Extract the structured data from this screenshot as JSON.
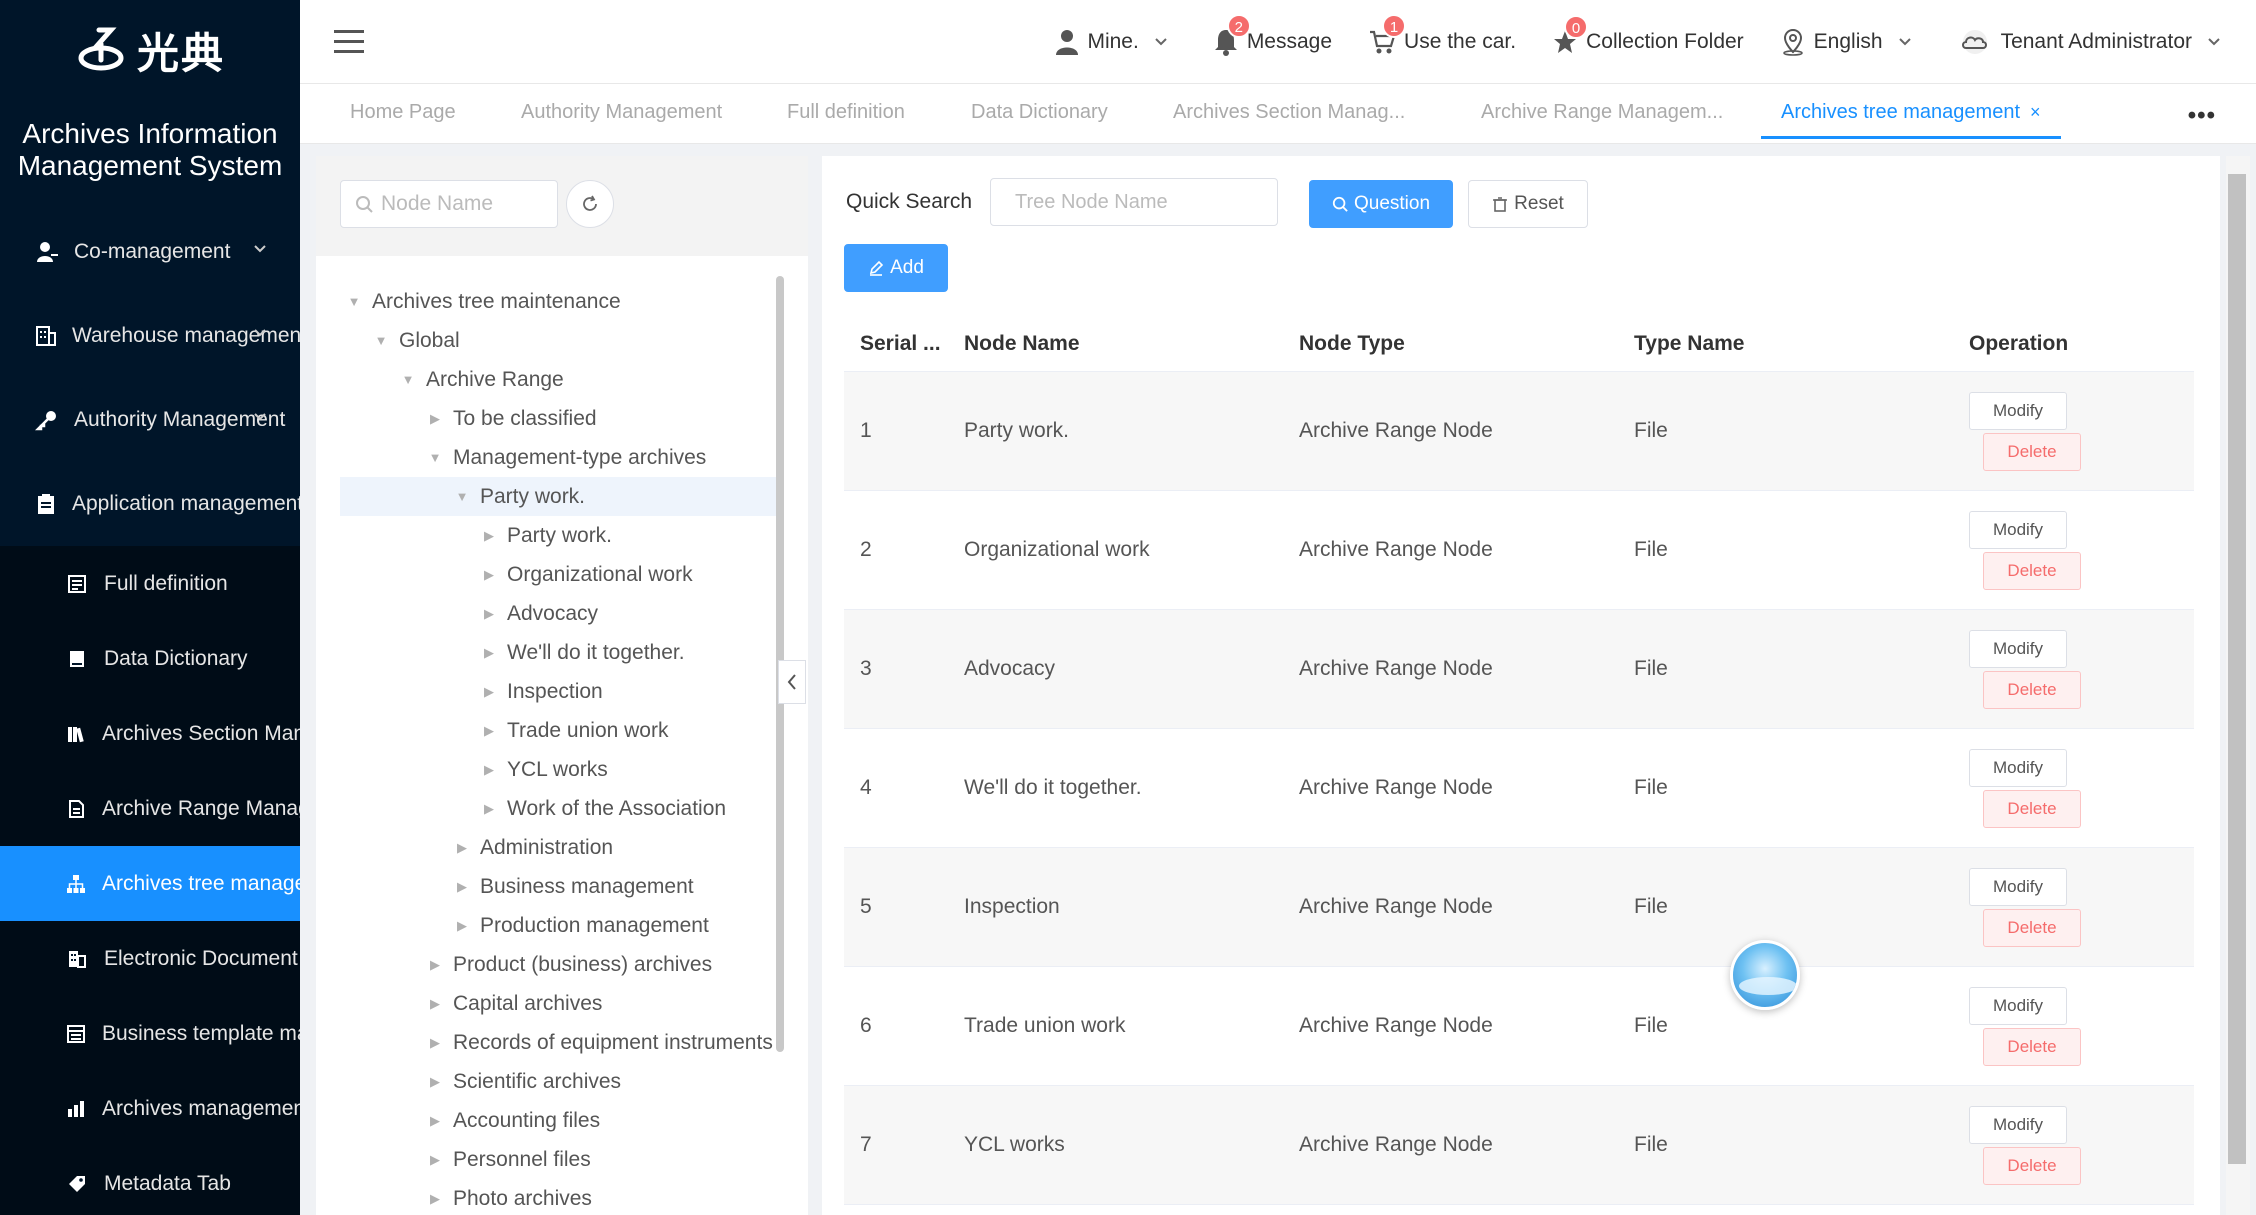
{
  "brand": {
    "logo_text": "光典",
    "app_title": "Archives Information Management System"
  },
  "sidebar": {
    "items": [
      {
        "label": "Co-management",
        "icon": "user-group-icon"
      },
      {
        "label": "Warehouse management",
        "icon": "building-icon"
      },
      {
        "label": "Authority Management",
        "icon": "key-icon"
      },
      {
        "label": "Application management",
        "icon": "clipboard-icon"
      }
    ],
    "sub_items": [
      {
        "label": "Full definition",
        "icon": "list-icon"
      },
      {
        "label": "Data Dictionary",
        "icon": "book-icon"
      },
      {
        "label": "Archives Section Management",
        "icon": "books-icon"
      },
      {
        "label": "Archive Range Management",
        "icon": "document-icon"
      },
      {
        "label": "Archives tree management",
        "icon": "hierarchy-icon"
      },
      {
        "label": "Electronic Document",
        "icon": "building-doc-icon"
      },
      {
        "label": "Business template management",
        "icon": "template-icon"
      },
      {
        "label": "Archives management",
        "icon": "chart-bars-icon"
      },
      {
        "label": "Metadata Tab",
        "icon": "tag-icon"
      }
    ]
  },
  "header": {
    "mine": "Mine.",
    "message": "Message",
    "message_badge": "2",
    "cart": "Use the car.",
    "cart_badge": "1",
    "collection": "Collection Folder",
    "collection_badge": "0",
    "language": "English",
    "user": "Tenant Administrator"
  },
  "tabs": [
    {
      "label": "Home Page"
    },
    {
      "label": "Authority Management"
    },
    {
      "label": "Full definition"
    },
    {
      "label": "Data Dictionary"
    },
    {
      "label": "Archives Section Manag..."
    },
    {
      "label": "Archive Range Managem..."
    },
    {
      "label": "Archives tree management",
      "close": "×"
    }
  ],
  "tree_panel": {
    "search_placeholder": "Node Name",
    "nodes": [
      {
        "label": "Archives tree maintenance",
        "level": 0,
        "expanded": true
      },
      {
        "label": "Global",
        "level": 1,
        "expanded": true
      },
      {
        "label": "Archive Range",
        "level": 2,
        "expanded": true
      },
      {
        "label": "To be classified",
        "level": 3,
        "expanded": false
      },
      {
        "label": "Management-type archives",
        "level": 3,
        "expanded": true
      },
      {
        "label": "Party work.",
        "level": 4,
        "expanded": true,
        "selected": true
      },
      {
        "label": "Party work.",
        "level": 5,
        "expanded": false
      },
      {
        "label": "Organizational work",
        "level": 5,
        "expanded": false
      },
      {
        "label": "Advocacy",
        "level": 5,
        "expanded": false
      },
      {
        "label": "We'll do it together.",
        "level": 5,
        "expanded": false
      },
      {
        "label": "Inspection",
        "level": 5,
        "expanded": false
      },
      {
        "label": "Trade union work",
        "level": 5,
        "expanded": false
      },
      {
        "label": "YCL works",
        "level": 5,
        "expanded": false
      },
      {
        "label": "Work of the Association",
        "level": 5,
        "expanded": false
      },
      {
        "label": "Administration",
        "level": 4,
        "expanded": false
      },
      {
        "label": "Business management",
        "level": 4,
        "expanded": false
      },
      {
        "label": "Production management",
        "level": 4,
        "expanded": false
      },
      {
        "label": "Product (business) archives",
        "level": 3,
        "expanded": false
      },
      {
        "label": "Capital archives",
        "level": 3,
        "expanded": false
      },
      {
        "label": "Records of equipment instruments",
        "level": 3,
        "expanded": false
      },
      {
        "label": "Scientific archives",
        "level": 3,
        "expanded": false
      },
      {
        "label": "Accounting files",
        "level": 3,
        "expanded": false
      },
      {
        "label": "Personnel files",
        "level": 3,
        "expanded": false
      },
      {
        "label": "Photo archives",
        "level": 3,
        "expanded": false
      }
    ]
  },
  "content": {
    "quick_search_label": "Quick Search",
    "quick_search_placeholder": "Tree Node Name",
    "question_btn": "Question",
    "reset_btn": "Reset",
    "add_btn": "Add",
    "columns": [
      "Serial ...",
      "Node Name",
      "Node Type",
      "Type Name",
      "Operation"
    ],
    "modify_label": "Modify",
    "delete_label": "Delete",
    "rows": [
      {
        "serial": "1",
        "name": "Party work.",
        "type": "Archive Range Node",
        "type_name": "File"
      },
      {
        "serial": "2",
        "name": "Organizational work",
        "type": "Archive Range Node",
        "type_name": "File"
      },
      {
        "serial": "3",
        "name": "Advocacy",
        "type": "Archive Range Node",
        "type_name": "File"
      },
      {
        "serial": "4",
        "name": "We'll do it together.",
        "type": "Archive Range Node",
        "type_name": "File"
      },
      {
        "serial": "5",
        "name": "Inspection",
        "type": "Archive Range Node",
        "type_name": "File"
      },
      {
        "serial": "6",
        "name": "Trade union work",
        "type": "Archive Range Node",
        "type_name": "File"
      },
      {
        "serial": "7",
        "name": "YCL works",
        "type": "Archive Range Node",
        "type_name": "File"
      }
    ]
  },
  "colors": {
    "sidebar_bg": "#001529",
    "accent": "#1890ff",
    "primary_btn": "#409eff",
    "danger": "#f56c6c"
  }
}
